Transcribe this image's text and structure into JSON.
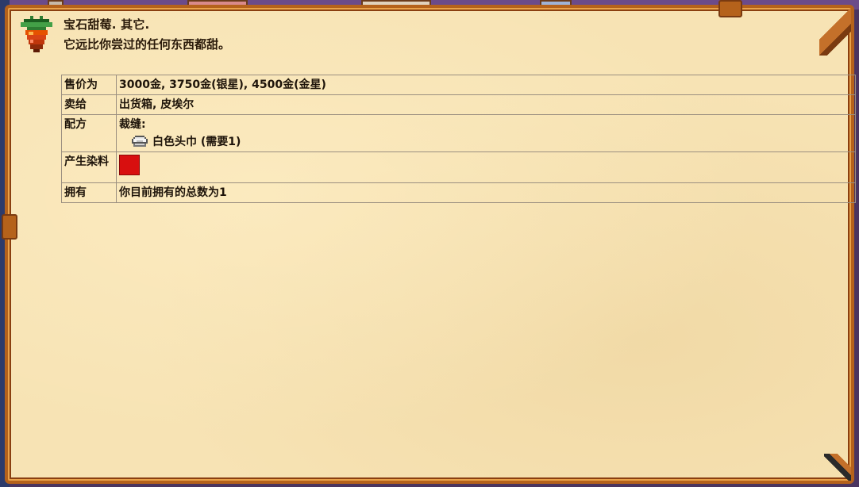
{
  "window": {
    "colors": {
      "parchment": "#f7e3b4",
      "frame": "#b5621b",
      "dye": "#d80f0f",
      "text": "#1e140a"
    }
  },
  "item": {
    "icon": "gem-berry-icon",
    "title": "宝石甜莓. 其它.",
    "description": "它远比你尝过的任何东西都甜。"
  },
  "table": {
    "rows": {
      "price": {
        "label": "售价为",
        "value": "3000金, 3750金(银星), 4500金(金星)"
      },
      "sell_to": {
        "label": "卖给",
        "value": "出货箱, 皮埃尔"
      },
      "recipe": {
        "label": "配方",
        "category": "裁缝:",
        "ingredient_icon": "white-turban-icon",
        "ingredient": "白色头巾 (需要1)"
      },
      "dye": {
        "label": "产生染料",
        "swatch_color": "#d80f0f"
      },
      "owned": {
        "label": "拥有",
        "value": "你目前拥有的总数为1"
      }
    }
  }
}
